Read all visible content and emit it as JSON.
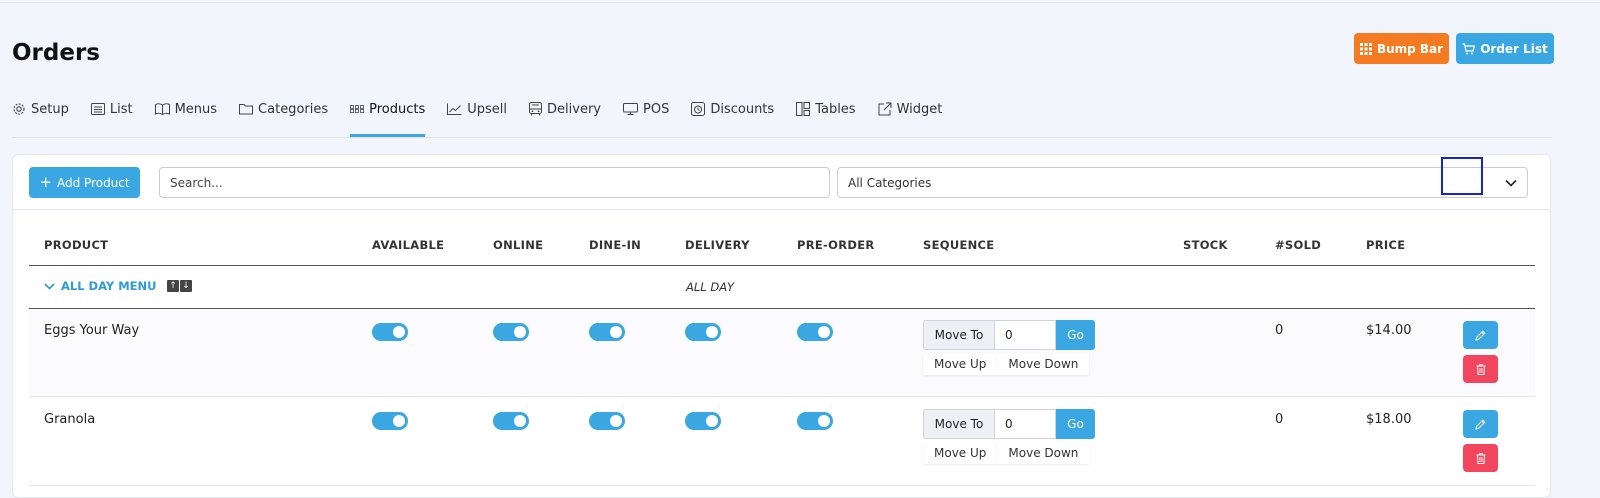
{
  "page": {
    "title": "Orders"
  },
  "header_buttons": {
    "bump_bar": "Bump Bar",
    "order_list": "Order List"
  },
  "tabs": [
    {
      "label": "Setup",
      "icon": "gear-icon"
    },
    {
      "label": "List",
      "icon": "list-icon"
    },
    {
      "label": "Menus",
      "icon": "book-icon"
    },
    {
      "label": "Categories",
      "icon": "folder-icon"
    },
    {
      "label": "Products",
      "icon": "grid-icon",
      "active": true
    },
    {
      "label": "Upsell",
      "icon": "chart-up-icon"
    },
    {
      "label": "Delivery",
      "icon": "bus-icon"
    },
    {
      "label": "POS",
      "icon": "monitor-icon"
    },
    {
      "label": "Discounts",
      "icon": "percent-icon"
    },
    {
      "label": "Tables",
      "icon": "tables-icon"
    },
    {
      "label": "Widget",
      "icon": "external-link-icon"
    }
  ],
  "toolbar": {
    "add_label": "Add Product",
    "search_placeholder": "Search...",
    "category_selected": "All Categories"
  },
  "table": {
    "headers": [
      "PRODUCT",
      "AVAILABLE",
      "ONLINE",
      "DINE-IN",
      "DELIVERY",
      "PRE-ORDER",
      "SEQUENCE",
      "STOCK",
      "#SOLD",
      "PRICE"
    ],
    "group": {
      "name": "ALL DAY MENU",
      "tag": "ALL DAY"
    },
    "rows": [
      {
        "name": "Eggs Your Way",
        "available": true,
        "online": true,
        "dine_in": true,
        "delivery": true,
        "pre_order": true,
        "sequence": "0",
        "stock": "",
        "sold": "0",
        "price": "$14.00"
      },
      {
        "name": "Granola",
        "available": true,
        "online": true,
        "dine_in": true,
        "delivery": true,
        "pre_order": true,
        "sequence": "0",
        "stock": "",
        "sold": "0",
        "price": "$18.00"
      }
    ],
    "sequence_labels": {
      "move_to": "Move To",
      "go": "Go",
      "move_up": "Move Up",
      "move_down": "Move Down"
    }
  },
  "colors": {
    "accent": "#3aa7e2",
    "orange": "#f57b22",
    "danger": "#f2465f"
  }
}
